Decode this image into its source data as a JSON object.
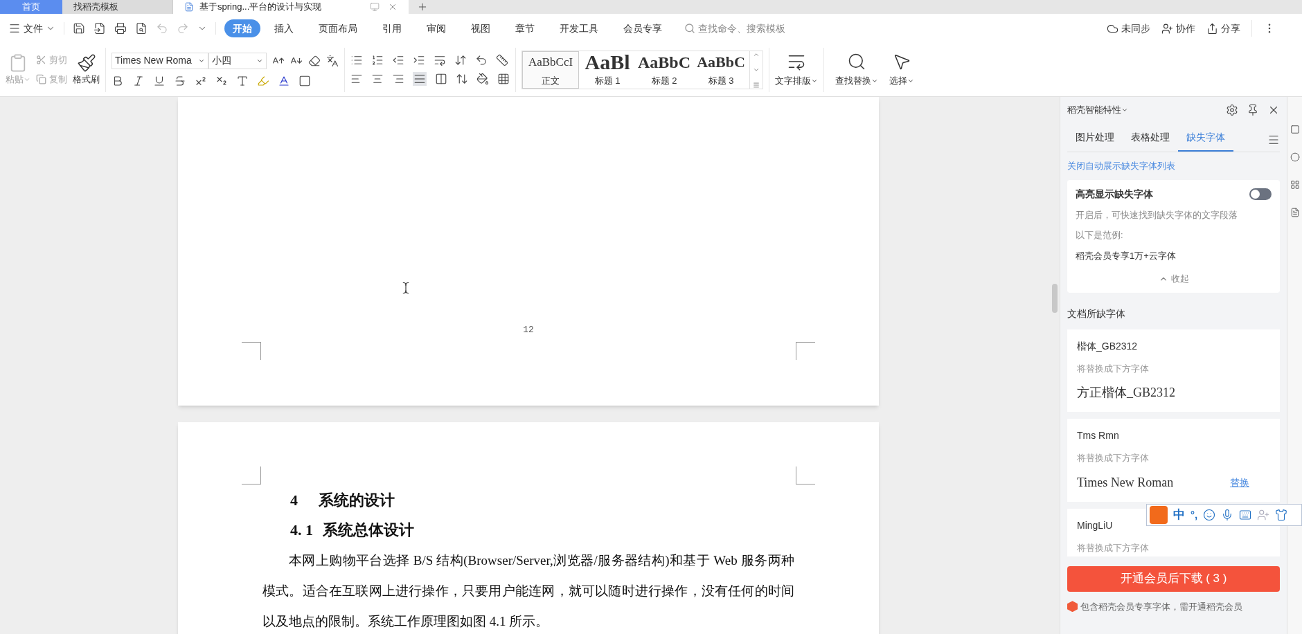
{
  "window_tabs": [
    {
      "label": "首页",
      "selected": false
    },
    {
      "label": "找稻壳模板",
      "selected": false
    },
    {
      "label": "基于spring...平台的设计与实现",
      "selected": true
    }
  ],
  "menu": {
    "file": "文件",
    "tabs": [
      {
        "label": "开始",
        "selected": true
      },
      {
        "label": "插入",
        "selected": false
      },
      {
        "label": "页面布局",
        "selected": false
      },
      {
        "label": "引用",
        "selected": false
      },
      {
        "label": "审阅",
        "selected": false
      },
      {
        "label": "视图",
        "selected": false
      },
      {
        "label": "章节",
        "selected": false
      },
      {
        "label": "开发工具",
        "selected": false
      },
      {
        "label": "会员专享",
        "selected": false
      }
    ],
    "search": {
      "placeholder": "查找命令、搜索模板"
    },
    "actions": [
      {
        "kind": "cloud",
        "label": "未同步"
      },
      {
        "kind": "collab",
        "label": "协作"
      },
      {
        "kind": "share",
        "label": "分享"
      }
    ]
  },
  "ribbon": {
    "paste": "粘贴",
    "cut": "剪切",
    "copy": "复制",
    "format_painter": "格式刷",
    "font_name": "Times New Roma",
    "font_size": "小四",
    "styles": [
      {
        "kind": "normal",
        "sample": "AaBbCcI",
        "label": "正文",
        "selected": true
      },
      {
        "kind": "h1",
        "sample": "AaBl",
        "label": "标题 1",
        "selected": false
      },
      {
        "kind": "h2",
        "sample": "AaBbC",
        "label": "标题 2",
        "selected": false
      },
      {
        "kind": "h3",
        "sample": "AaBbC",
        "label": "标题 3",
        "selected": false
      }
    ],
    "text_layout": "文字排版",
    "find_replace": "查找替换",
    "select": "选择"
  },
  "document": {
    "page_number": "12",
    "heading_number": "4",
    "heading": "系统的设计",
    "subheading_number": "4. 1",
    "subheading": "系统总体设计",
    "paragraph": "本网上购物平台选择 B/S 结构(Browser/Server,浏览器/服务器结构)和基于 Web 服务两种模式。适合在互联网上进行操作，只要用户能连网，就可以随时进行操作，没有任何的时间以及地点的限制。系统工作原理图如图 4.1 所示。"
  },
  "panel": {
    "title": "稻壳智能特性",
    "tabs": [
      {
        "label": "图片处理",
        "selected": false
      },
      {
        "label": "表格处理",
        "selected": false
      },
      {
        "label": "缺失字体",
        "selected": true
      }
    ],
    "link": "关闭自动展示缺失字体列表",
    "highlight": {
      "title": "高亮显示缺失字体",
      "on": false,
      "description": "开启后，可快速找到缺失字体的文字段落",
      "example_label": "以下是范例:",
      "example": "稻壳会员专享1万+云字体",
      "collapse": "收起"
    },
    "missing_title": "文档所缺字体",
    "fonts": [
      {
        "name": "楷体_GB2312",
        "hint": "将替换成下方字体",
        "replacement": "方正楷体_GB2312"
      },
      {
        "name": "Tms Rmn",
        "hint": "将替换成下方字体",
        "replacement": "Times New Roman",
        "action": "替换"
      },
      {
        "name": "MingLiU",
        "hint": "将替换成下方字体"
      }
    ],
    "download_button": "开通会员后下载 ( 3 )",
    "note": "包含稻壳会员专享字体，需开通稻壳会员"
  },
  "ime": {
    "mode": "中",
    "punctuation": "°,"
  }
}
